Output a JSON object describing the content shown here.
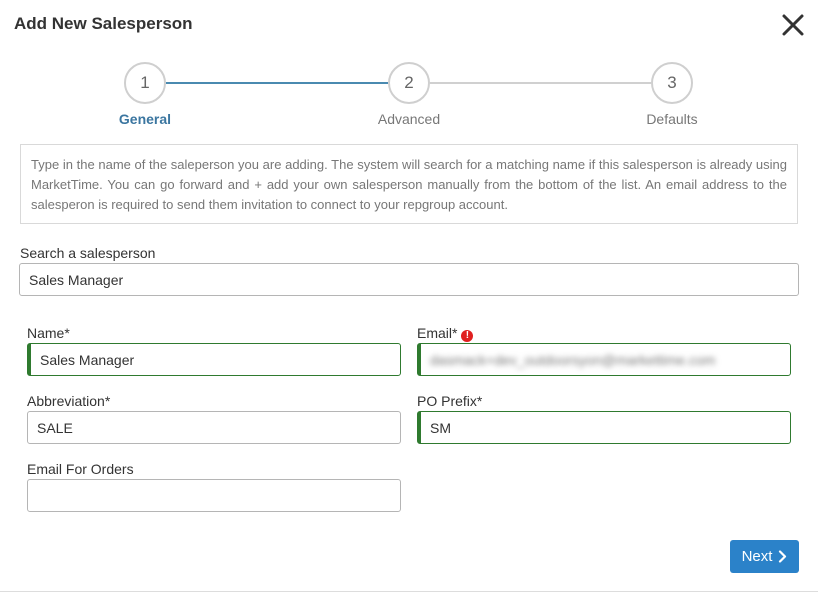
{
  "dialog": {
    "title": "Add New Salesperson",
    "close_icon": "close-icon"
  },
  "stepper": {
    "steps": [
      {
        "number": "1",
        "label": "General",
        "state": "current"
      },
      {
        "number": "2",
        "label": "Advanced",
        "state": "pending"
      },
      {
        "number": "3",
        "label": "Defaults",
        "state": "pending"
      }
    ]
  },
  "info_text": "Type in the name of the saleperson you are adding. The system will search for a matching name if this salesperson is already using MarketTime. You can go forward and + add your own salesperson manually from the bottom of the list. An email address to the salesperon is required to send them invitation to connect to your repgroup account.",
  "search": {
    "label": "Search a salesperson",
    "value": "Sales Manager"
  },
  "form": {
    "name_label": "Name*",
    "name_value": "Sales Manager",
    "email_label": "Email*",
    "email_value": "dasmack+dev_outdoorsyon@markettime.com",
    "abbreviation_label": "Abbreviation*",
    "abbreviation_value": "SALE",
    "po_prefix_label": "PO Prefix*",
    "po_prefix_value": "SM",
    "email_orders_label": "Email For Orders",
    "email_orders_value": ""
  },
  "footer": {
    "next_label": "Next"
  },
  "colors": {
    "accent": "#2b82c9",
    "step_active": "#3b76a0",
    "valid_border": "#2f7a2f",
    "error": "#e02020"
  }
}
